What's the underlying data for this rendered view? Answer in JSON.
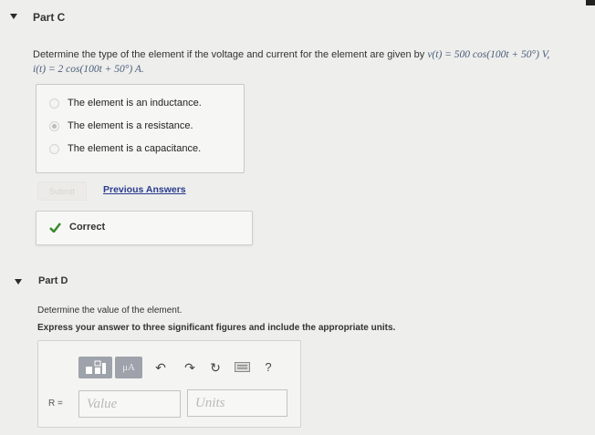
{
  "part_c": {
    "title": "Part C",
    "prompt_text": "Determine the type of the element if the voltage and current for the element are given by",
    "voltage_expr": "v(t) = 500 cos(100t + 50°) V,",
    "current_expr": "i(t) = 2 cos(100t + 50°) A.",
    "choices": [
      {
        "label": "The element is an inductance.",
        "selected": false
      },
      {
        "label": "The element is a resistance.",
        "selected": true
      },
      {
        "label": "The element is a capacitance.",
        "selected": false
      }
    ],
    "submit_label": "Submit",
    "previous_answers_label": "Previous Answers",
    "correct_label": "Correct"
  },
  "part_d": {
    "title": "Part D",
    "prompt": "Determine the value of the element.",
    "instruction": "Express your answer to three significant figures and include the appropriate units.",
    "toolbar": {
      "units_button_label": "μA",
      "help_label": "?"
    },
    "variable_label": "R =",
    "value_placeholder": "Value",
    "units_placeholder": "Units"
  },
  "colors": {
    "background": "#eeeeec",
    "link": "#2a3b8f",
    "check": "#3a8a2a",
    "math": "#4a5d7a"
  }
}
